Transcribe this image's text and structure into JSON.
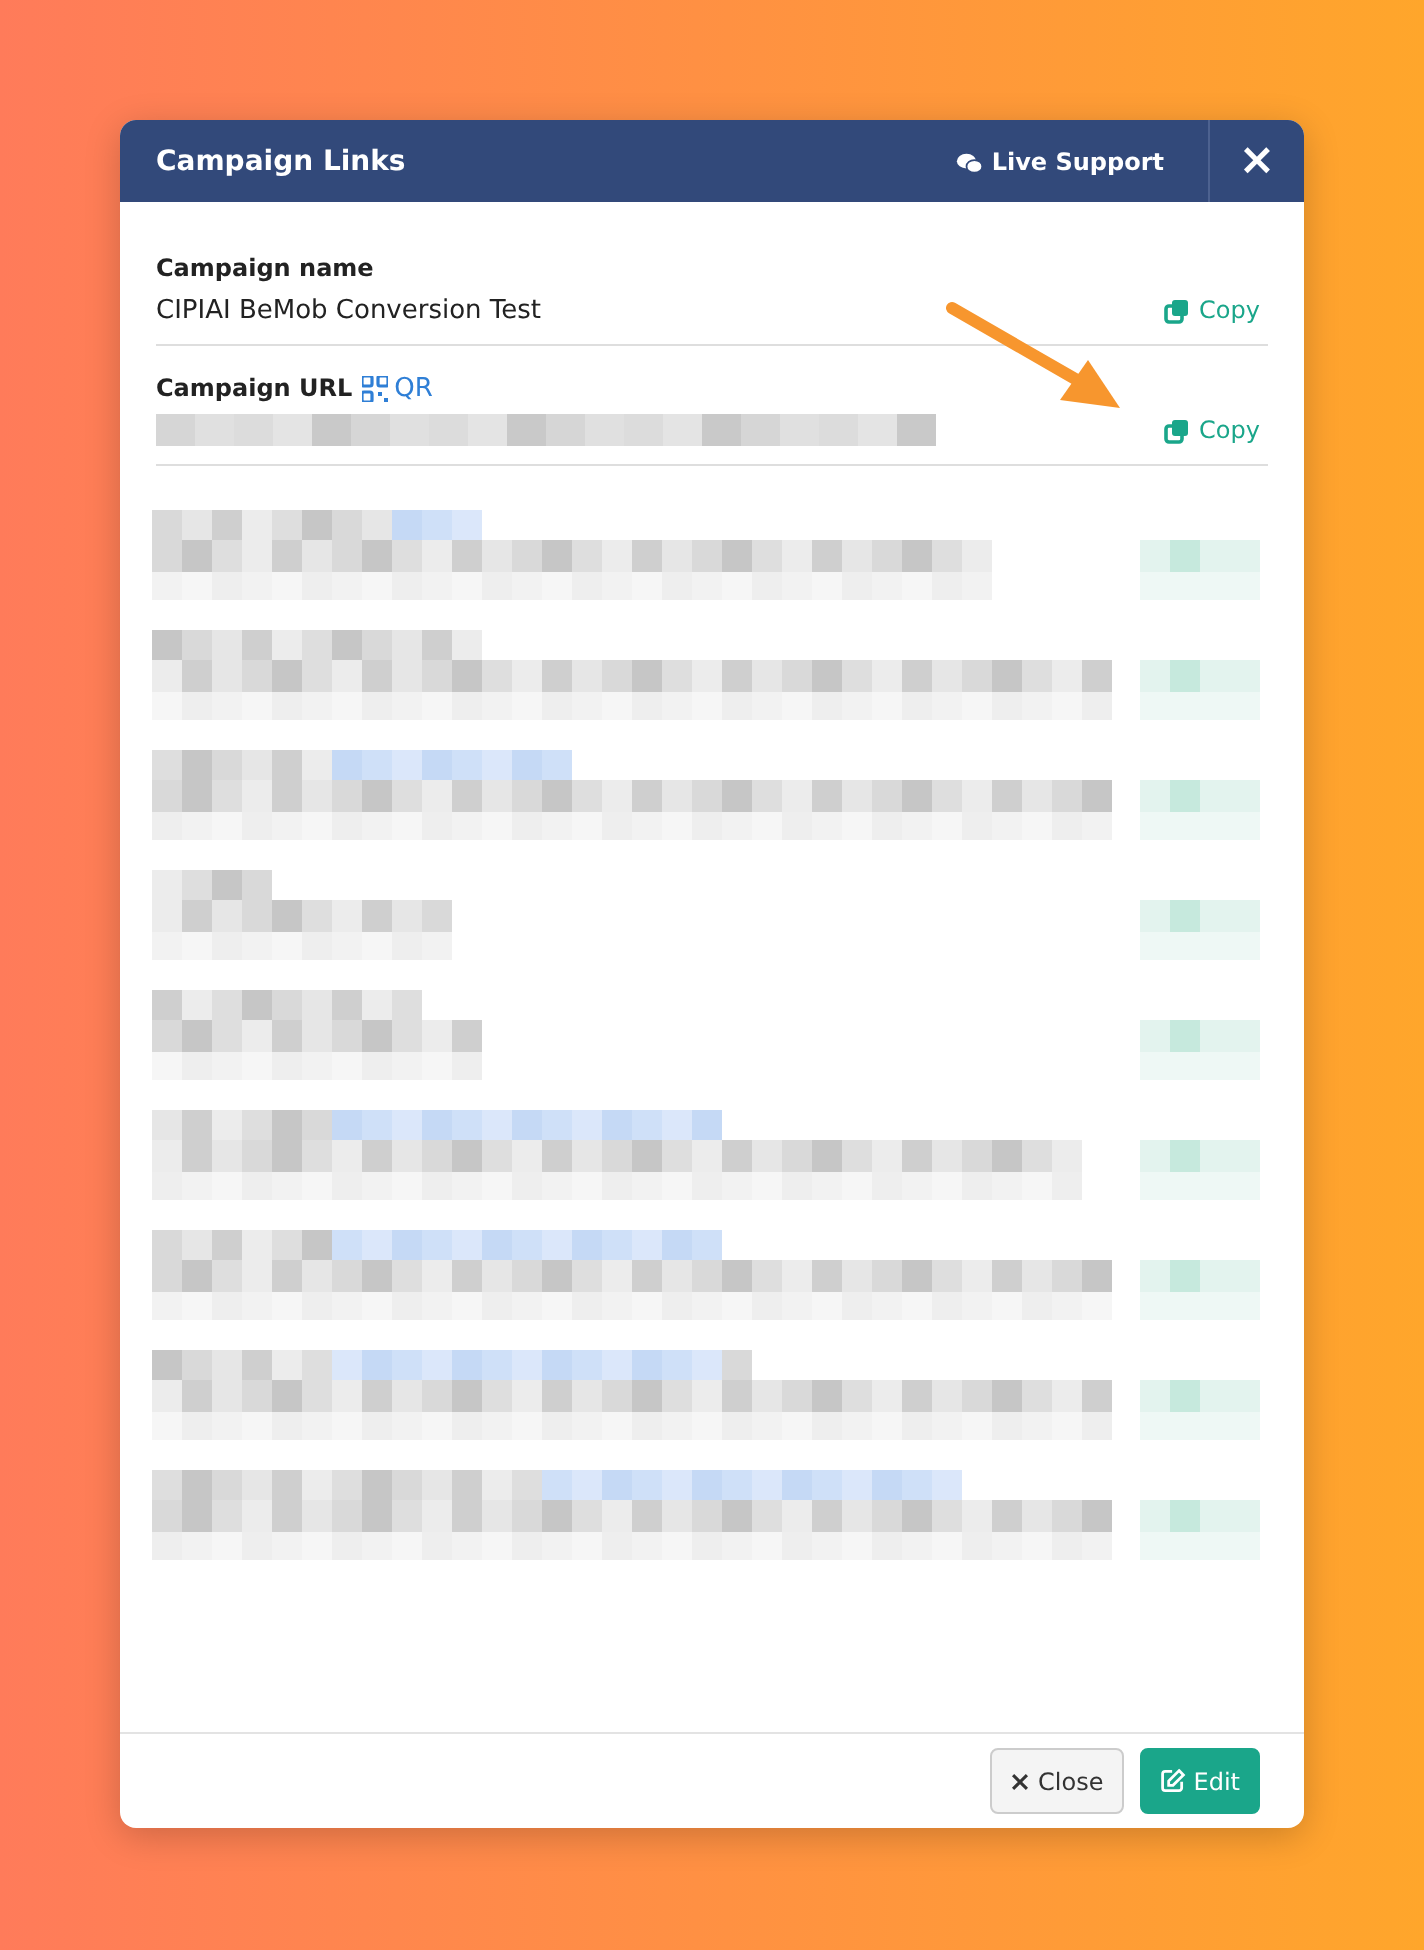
{
  "window": {
    "title": "Campaign Links",
    "support": "Live Support",
    "close": "×"
  },
  "fields": [
    {
      "label": "Campaign name",
      "value": "CIPIAI BeMob Conversion Test",
      "copy": "Copy"
    },
    {
      "label": "Campaign URL",
      "qr": "QR",
      "copy": "Copy"
    }
  ],
  "buttons": [
    {
      "label": "Close",
      "kind": "secondary"
    },
    {
      "label": "Edit",
      "kind": "primary"
    }
  ]
}
